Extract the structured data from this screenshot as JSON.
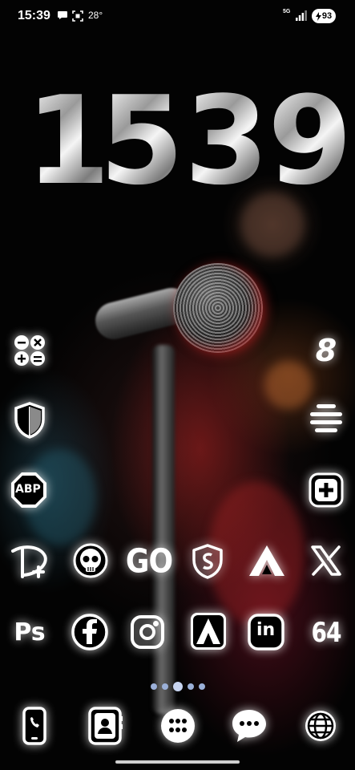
{
  "status_bar": {
    "time": "15:39",
    "temperature": "28°",
    "network": "5G",
    "battery": "93"
  },
  "clock_widget": {
    "digits": [
      "1",
      "5",
      "3",
      "9"
    ]
  },
  "home_screen": {
    "page_count": 5,
    "active_page": 3,
    "rows": [
      [
        "calculator-icon",
        "",
        "",
        "",
        "",
        "number-8-icon"
      ],
      [
        "shield-icon",
        "",
        "",
        "",
        "",
        "menu-lines-icon"
      ],
      [
        "adblock-plus-icon",
        "",
        "",
        "",
        "",
        "plus-square-icon"
      ],
      [
        "disney-plus-icon",
        "skull-icon",
        "go-icon",
        "shield-s-icon",
        "arrow-logo-icon",
        "x-icon"
      ],
      [
        "photoshop-icon",
        "facebook-icon",
        "instagram-icon",
        "adobe-acrobat-icon",
        "linkedin-icon",
        "64-icon"
      ]
    ],
    "labels": {
      "abp": "ABP",
      "ps": "Ps",
      "go": "GO",
      "sixty_four": "64",
      "eight": "8",
      "in": "in"
    }
  },
  "dock": [
    "phone-icon",
    "contacts-icon",
    "app-drawer-icon",
    "messages-icon",
    "browser-icon"
  ],
  "colors": {
    "glow": "#ffffff",
    "page_dot": "#9bb0d8",
    "battery_bg": "#ffffff"
  }
}
